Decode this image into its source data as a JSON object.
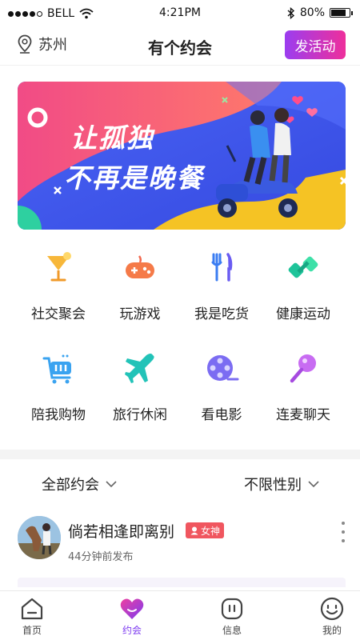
{
  "status_bar": {
    "carrier": "BELL",
    "time": "4:21PM",
    "battery": "80%",
    "battery_level": 0.8
  },
  "header": {
    "location": "苏州",
    "title": "有个约会",
    "publish_label": "发活动"
  },
  "banner": {
    "line1": "让孤独",
    "line2": "不再是晚餐"
  },
  "categories": [
    {
      "label": "社交聚会",
      "icon": "cocktail-icon"
    },
    {
      "label": "玩游戏",
      "icon": "gamepad-icon"
    },
    {
      "label": "我是吃货",
      "icon": "fork-knife-icon"
    },
    {
      "label": "健康运动",
      "icon": "dumbbell-icon"
    },
    {
      "label": "陪我购物",
      "icon": "shopping-cart-icon"
    },
    {
      "label": "旅行休闲",
      "icon": "airplane-icon"
    },
    {
      "label": "看电影",
      "icon": "film-reel-icon"
    },
    {
      "label": "连麦聊天",
      "icon": "microphone-icon"
    }
  ],
  "filters": {
    "type": "全部约会",
    "gender": "不限性别"
  },
  "post": {
    "name": "倘若相逢即离别",
    "badge": "女神",
    "time": "44分钟前发布"
  },
  "tabs": [
    {
      "label": "首页",
      "icon": "home-icon"
    },
    {
      "label": "约会",
      "icon": "heart-icon"
    },
    {
      "label": "信息",
      "icon": "message-icon"
    },
    {
      "label": "我的",
      "icon": "profile-icon"
    }
  ],
  "colors": {
    "accent_purple": "#7d3bf0",
    "publish_gradient_start": "#9b3df0",
    "publish_gradient_end": "#ee2f9b",
    "badge_red": "#f0565f",
    "banner_blue": "#3b5bef"
  }
}
